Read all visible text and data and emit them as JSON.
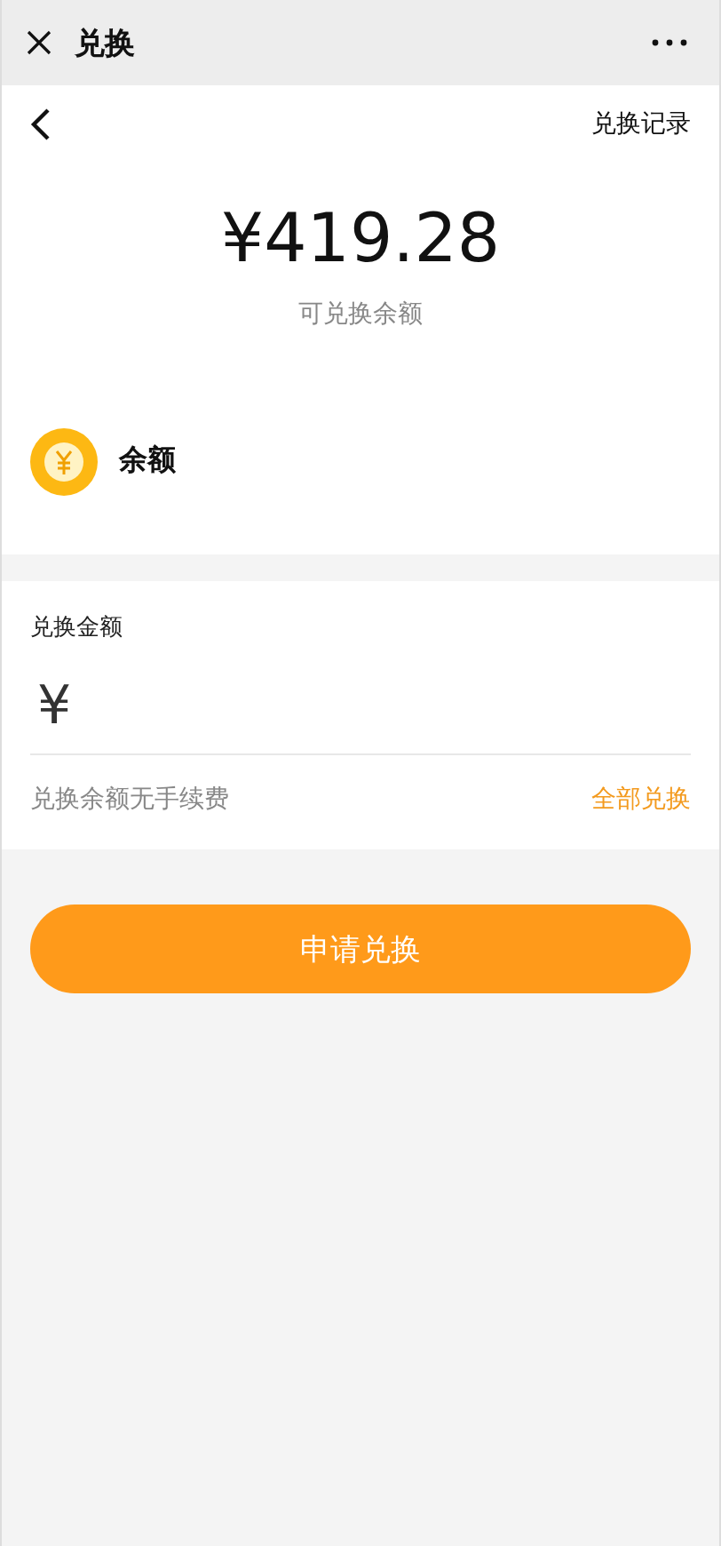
{
  "window": {
    "title": "兑换"
  },
  "nav": {
    "records_link": "兑换记录"
  },
  "balance": {
    "amount": "¥419.28",
    "caption": "可兑换余额"
  },
  "account": {
    "label": "余额"
  },
  "exchange": {
    "label": "兑换金额",
    "currency": "¥",
    "note": "兑换余额无手续费",
    "all_link": "全部兑换"
  },
  "submit_button": "申请兑换"
}
